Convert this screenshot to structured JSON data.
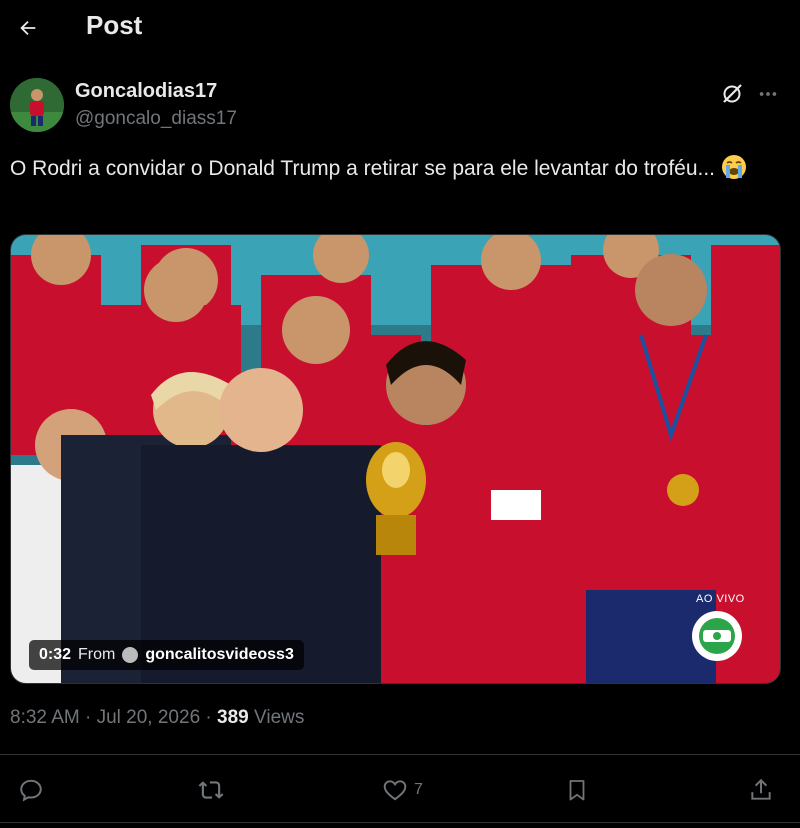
{
  "header": {
    "back_icon": "arrow-left-icon",
    "title": "Post"
  },
  "author": {
    "name": "Goncalodias17",
    "handle": "@goncalo_diass17"
  },
  "post": {
    "text": "O Rodri a convidar o Donald Trump a retirar se para ele levantar do troféu...",
    "emoji": "loudly-crying-face"
  },
  "video": {
    "duration": "0:32",
    "from_label": "From",
    "from_user": "goncalitosvideoss3",
    "overlay_text": "AO VIVO"
  },
  "meta": {
    "time": "8:32 AM",
    "date": "Jul 20, 2026",
    "views_count": "389",
    "views_label": "Views"
  },
  "actions": {
    "reply_icon": "reply-icon",
    "repost_icon": "repost-icon",
    "like_icon": "heart-icon",
    "like_count": "7",
    "bookmark_icon": "bookmark-icon",
    "share_icon": "share-icon"
  },
  "colors": {
    "background": "#000000",
    "text": "#e7e9ea",
    "secondary": "#71767b",
    "divider": "#2f3336"
  }
}
